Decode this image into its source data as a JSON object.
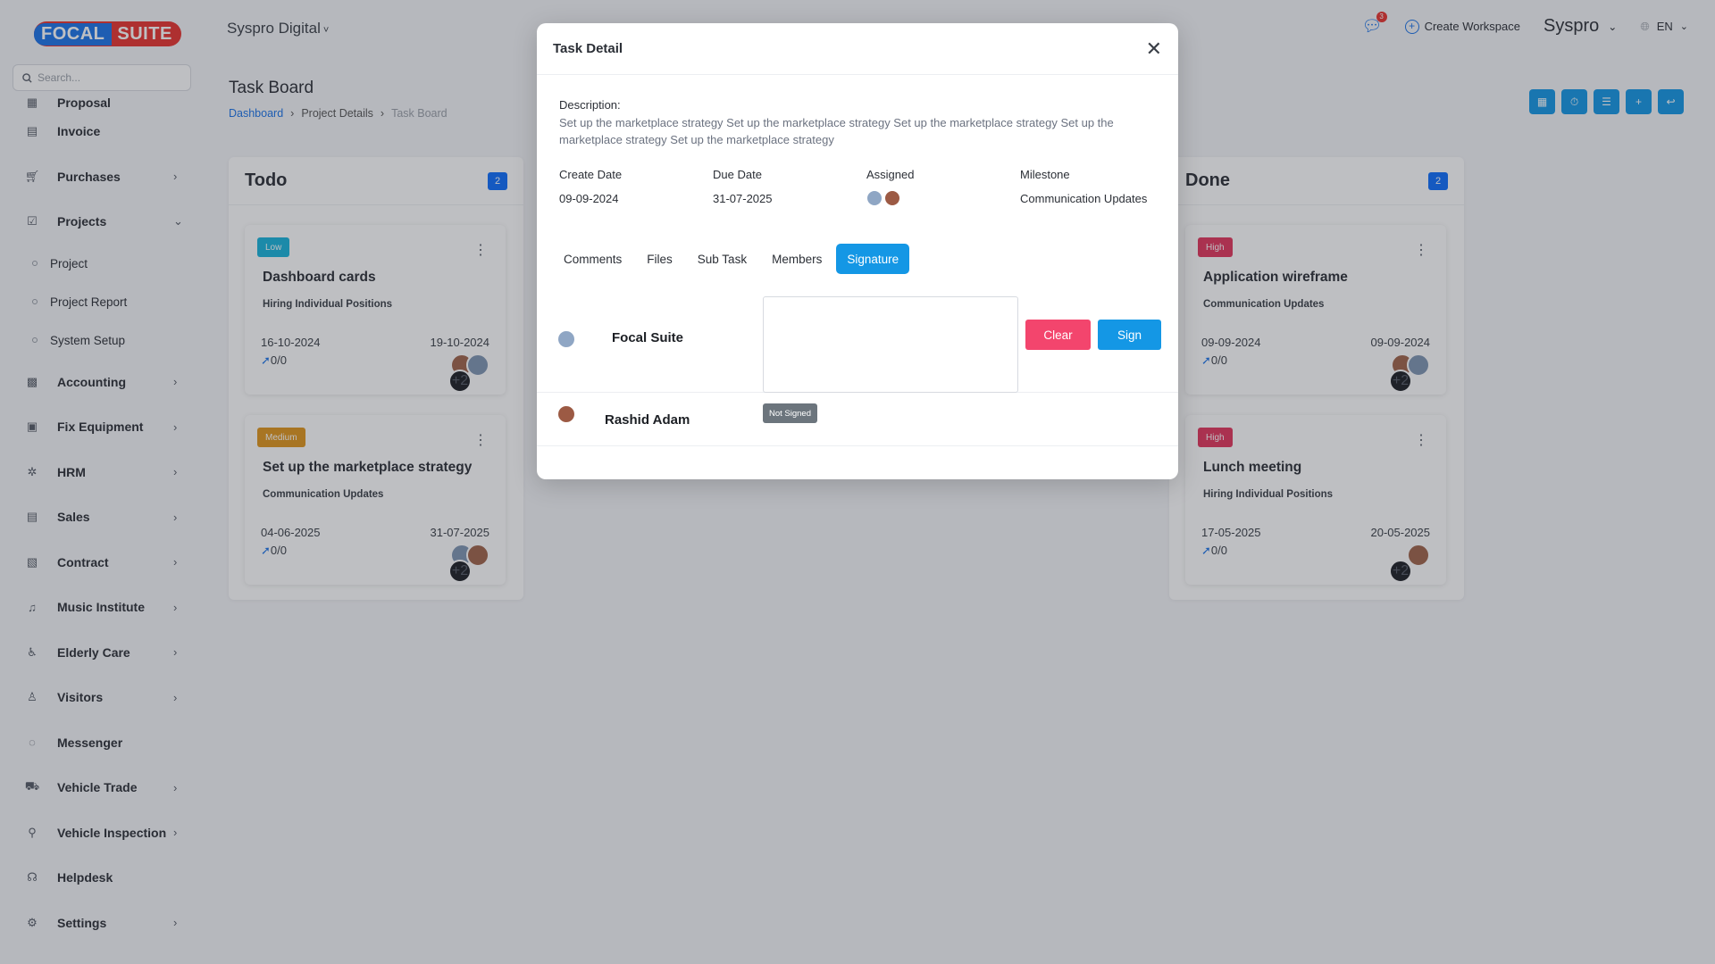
{
  "brand": {
    "part1": "FOCAL",
    "part2": "SUITE"
  },
  "search": {
    "placeholder": "Search..."
  },
  "sidebar": {
    "items": [
      {
        "label": "Proposal",
        "icon": "proposal-icon",
        "has_chevron": false
      },
      {
        "label": "Invoice",
        "icon": "invoice-icon",
        "has_chevron": false
      },
      {
        "label": "Purchases",
        "icon": "cart-icon",
        "has_chevron": true
      },
      {
        "label": "Projects",
        "icon": "projects-icon",
        "has_chevron": true,
        "expanded": true
      },
      {
        "label": "Accounting",
        "icon": "accounting-icon",
        "has_chevron": true
      },
      {
        "label": "Fix Equipment",
        "icon": "archive-icon",
        "has_chevron": true
      },
      {
        "label": "HRM",
        "icon": "hrm-icon",
        "has_chevron": true
      },
      {
        "label": "Sales",
        "icon": "sales-icon",
        "has_chevron": true
      },
      {
        "label": "Contract",
        "icon": "contract-icon",
        "has_chevron": true
      },
      {
        "label": "Music Institute",
        "icon": "music-icon",
        "has_chevron": true
      },
      {
        "label": "Elderly Care",
        "icon": "elderly-icon",
        "has_chevron": true
      },
      {
        "label": "Visitors",
        "icon": "visitor-icon",
        "has_chevron": true
      },
      {
        "label": "Messenger",
        "icon": "messenger-icon",
        "has_chevron": false
      },
      {
        "label": "Vehicle Trade",
        "icon": "vehicle-icon",
        "has_chevron": true
      },
      {
        "label": "Vehicle Inspection",
        "icon": "bike-icon",
        "has_chevron": true
      },
      {
        "label": "Helpdesk",
        "icon": "headset-icon",
        "has_chevron": false
      },
      {
        "label": "Settings",
        "icon": "gear-icon",
        "has_chevron": true
      }
    ],
    "projects_sub": [
      "Project",
      "Project Report",
      "System Setup"
    ]
  },
  "header": {
    "workspace": "Syspro  Digital",
    "notification_count": "3",
    "create_workspace": "Create Workspace",
    "company": "Syspro",
    "language": "EN"
  },
  "page": {
    "title": "Task Board",
    "breadcrumb": [
      "Dashboard",
      "Project Details",
      "Task Board"
    ]
  },
  "board": {
    "columns": [
      {
        "title": "Todo",
        "count": "2",
        "cards": [
          {
            "priority": "Low",
            "priority_color": "#17b4dc",
            "title": "Dashboard cards",
            "milestone": "Hiring Individual Positions",
            "start": "16-10-2024",
            "end": "19-10-2024",
            "tasks": "0/0",
            "more_count": "+2"
          },
          {
            "priority": "Medium",
            "priority_color": "#e0961c",
            "title": "Set up the marketplace strategy",
            "milestone": "Communication Updates",
            "start": "04-06-2025",
            "end": "31-07-2025",
            "tasks": "0/0",
            "more_count": "+2"
          }
        ]
      },
      {
        "title": "Done",
        "count": "2",
        "cards": [
          {
            "priority": "High",
            "priority_color": "#e2355c",
            "title": "Application wireframe",
            "milestone": "Communication Updates",
            "start": "09-09-2024",
            "end": "09-09-2024",
            "tasks": "0/0",
            "more_count": "+2"
          },
          {
            "priority": "High",
            "priority_color": "#e2355c",
            "title": "Lunch meeting",
            "milestone": "Hiring Individual Positions",
            "start": "17-05-2025",
            "end": "20-05-2025",
            "tasks": "0/0",
            "more_count": "+2"
          }
        ]
      }
    ]
  },
  "modal": {
    "title": "Task Detail",
    "description_label": "Description:",
    "description": "Set up the marketplace strategy Set up the marketplace strategy Set up the marketplace strategy Set up the marketplace strategy Set up the marketplace strategy",
    "create_date_label": "Create Date",
    "create_date": "09-09-2024",
    "due_date_label": "Due Date",
    "due_date": "31-07-2025",
    "assigned_label": "Assigned",
    "milestone_label": "Milestone",
    "milestone": "Communication Updates",
    "tabs": [
      "Comments",
      "Files",
      "Sub Task",
      "Members",
      "Signature"
    ],
    "active_tab": "Signature",
    "signatures": [
      {
        "name": "Focal Suite",
        "clear_label": "Clear",
        "sign_label": "Sign"
      },
      {
        "name": "Rashid Adam",
        "status": "Not Signed"
      }
    ]
  }
}
